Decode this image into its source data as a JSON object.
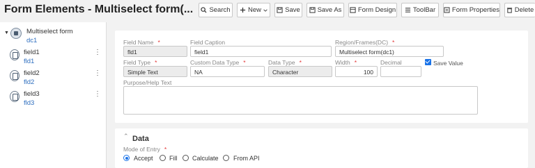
{
  "app": {
    "title": "Form Elements - Multiselect form(..."
  },
  "toolbar": {
    "search": "Search",
    "new": "New",
    "save": "Save",
    "save_as": "Save As",
    "form_design": "Form Design",
    "toolbar": "ToolBar",
    "form_properties": "Form Properties",
    "delete": "Delete"
  },
  "sidebar": {
    "root": {
      "label": "Multiselect form",
      "sub": "dc1"
    },
    "fields": [
      {
        "label": "field1",
        "sub": "fld1"
      },
      {
        "label": "field2",
        "sub": "fld2"
      },
      {
        "label": "field3",
        "sub": "fld3"
      }
    ]
  },
  "form": {
    "field_name": {
      "label": "Field Name",
      "value": "fld1"
    },
    "field_caption": {
      "label": "Field Caption",
      "value": "field1"
    },
    "region": {
      "label": "Region/Frames(DC)",
      "value": "Multiselect form(dc1)"
    },
    "field_type": {
      "label": "Field Type",
      "value": "Simple Text"
    },
    "custom_data_type": {
      "label": "Custom Data Type",
      "value": "NA"
    },
    "data_type": {
      "label": "Data Type",
      "value": "Character"
    },
    "width": {
      "label": "Width",
      "value": "100"
    },
    "decimal": {
      "label": "Decimal",
      "value": ""
    },
    "save_value": {
      "label": "Save Value",
      "checked": true
    },
    "purpose": {
      "label": "Purpose/Help Text",
      "value": ""
    }
  },
  "data_section": {
    "title": "Data",
    "mode_label": "Mode of Entry",
    "options": [
      "Accept",
      "Fill",
      "Calculate",
      "From API"
    ],
    "selected": "Accept"
  },
  "required_mark": "*",
  "colors": {
    "accent": "#1a73e8",
    "link": "#2f6fbf",
    "required": "#e23333"
  }
}
